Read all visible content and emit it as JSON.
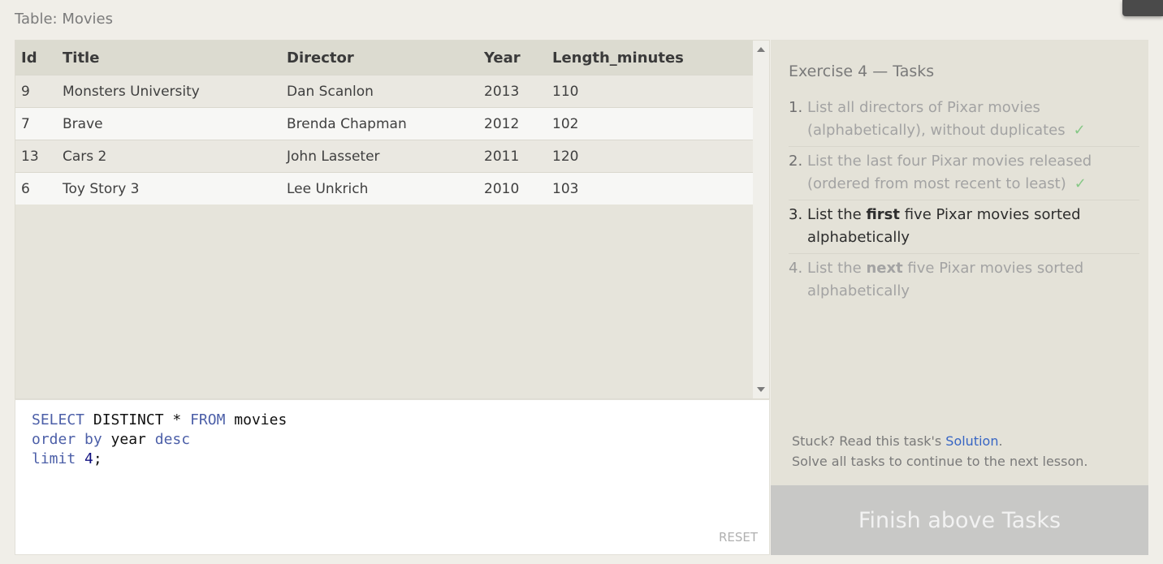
{
  "table_label": "Table: Movies",
  "results": {
    "columns": [
      "Id",
      "Title",
      "Director",
      "Year",
      "Length_minutes"
    ],
    "rows": [
      [
        "9",
        "Monsters University",
        "Dan Scanlon",
        "2013",
        "110"
      ],
      [
        "7",
        "Brave",
        "Brenda Chapman",
        "2012",
        "102"
      ],
      [
        "13",
        "Cars 2",
        "John Lasseter",
        "2011",
        "120"
      ],
      [
        "6",
        "Toy Story 3",
        "Lee Unkrich",
        "2010",
        "103"
      ]
    ]
  },
  "editor": {
    "line1": {
      "kw1": "SELECT",
      "plain1": " DISTINCT * ",
      "kw2": "FROM",
      "plain2": " movies"
    },
    "line2": {
      "kw1": "order by",
      "plain1": " year ",
      "kw2": "desc"
    },
    "line3": {
      "kw1": "limit",
      "num": " 4",
      "plain1": ";"
    },
    "reset_label": "RESET"
  },
  "tasks": {
    "heading": "Exercise 4 — Tasks",
    "items": [
      {
        "num": "1.",
        "text": "List all directors of Pixar movies (alphabetically), without duplicates",
        "check": "✓"
      },
      {
        "num": "2.",
        "text": "List the last four Pixar movies released (ordered from most recent to least)",
        "check": "✓"
      },
      {
        "num": "3.",
        "pre": "List the ",
        "bold": "first",
        "post": " five Pixar movies sorted alphabetically"
      },
      {
        "num": "4.",
        "pre": "List the ",
        "bold": "next",
        "post": " five Pixar movies sorted alphabetically"
      }
    ],
    "stuck_pre": "Stuck? Read this task's ",
    "solution_link": "Solution",
    "stuck_post": ".",
    "solve_all": "Solve all tasks to continue to the next lesson.",
    "finish_button": "Finish above Tasks"
  }
}
